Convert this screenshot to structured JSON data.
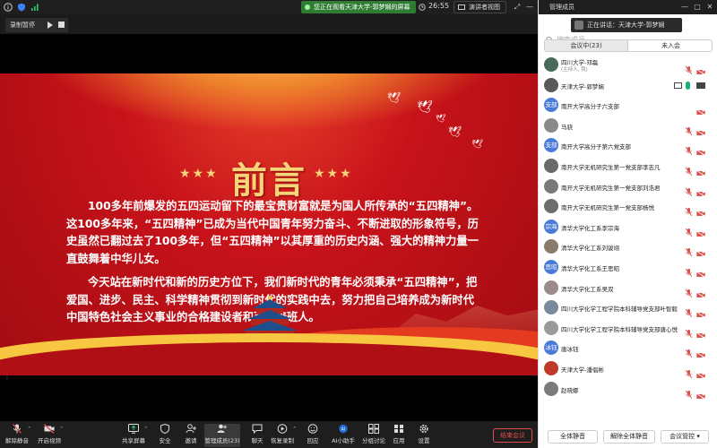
{
  "topbar": {
    "sharing_text": "您正在观看天津大学-郭梦娴的屏幕",
    "clock": "26:55",
    "view_button": "演讲者视图"
  },
  "recording": {
    "label": "录制暂停"
  },
  "slide": {
    "title": "前言",
    "stars_left": "★★★",
    "stars_right": "★★★",
    "paragraph1": "100多年前爆发的五四运动留下的最宝贵财富就是为国人所传承的“五四精神”。这100多年来，“五四精神”已成为当代中国青年努力奋斗、不断进取的形象符号，历史虽然已翻过去了100多年，但“五四精神”以其厚重的历史内涵、强大的精神力量一直鼓舞着中华儿女。",
    "paragraph2": "今天站在新时代和新的历史方位下，我们新时代的青年必须秉承“五四精神”，把爱国、进步、民主、科学精神贯彻到新时代的实践中去，努力把自己培养成为新时代中国特色社会主义事业的合格建设者和可靠接班人。"
  },
  "toolbar": {
    "items": [
      {
        "label": "解除静音",
        "icon": "mic-muted-icon"
      },
      {
        "label": "开启视频",
        "icon": "video-off-icon"
      },
      {
        "label": "共享屏幕",
        "icon": "share-screen-icon"
      },
      {
        "label": "安全",
        "icon": "shield-icon"
      },
      {
        "label": "邀请",
        "icon": "invite-icon"
      },
      {
        "label": "管理成员(23)",
        "icon": "members-icon"
      },
      {
        "label": "聊天",
        "icon": "chat-icon"
      },
      {
        "label": "恢复录制",
        "icon": "record-icon"
      },
      {
        "label": "回应",
        "icon": "reaction-icon"
      },
      {
        "label": "AI小助手",
        "icon": "ai-assistant-icon"
      },
      {
        "label": "分组讨论",
        "icon": "breakout-icon"
      },
      {
        "label": "应用",
        "icon": "apps-icon"
      },
      {
        "label": "设置",
        "icon": "gear-icon"
      }
    ],
    "end_meeting": "结束会议"
  },
  "panel": {
    "title": "管理成员",
    "speaking": "正在讲话：天津大学-郭梦娴",
    "search_placeholder": "搜索成员",
    "tabs": [
      {
        "label": "会议中(23)"
      },
      {
        "label": "未入会"
      }
    ],
    "participants": [
      {
        "name": "四川大学-邓磊",
        "sub": "(主持人, 我)",
        "avatar": "",
        "avatar_color": "#4a6b5a",
        "state": "muted"
      },
      {
        "name": "天津大学-郭梦娴",
        "sub": "",
        "avatar": "",
        "avatar_color": "#5a5a5a",
        "state": "speaking"
      },
      {
        "name": "南开大学高分子六支部",
        "sub": "",
        "avatar": "支部",
        "avatar_color": "#4b7bd9",
        "state": "camoff"
      },
      {
        "name": "马骁",
        "sub": "",
        "avatar": "",
        "avatar_color": "#8a8a8a",
        "state": "muted"
      },
      {
        "name": "南开大学高分子第六党支部",
        "sub": "",
        "avatar": "支部",
        "avatar_color": "#4b7bd9",
        "state": "muted"
      },
      {
        "name": "南开大学无机研究生第一党支部李志凡",
        "sub": "",
        "avatar": "",
        "avatar_color": "#6a6a6a",
        "state": "muted"
      },
      {
        "name": "南开大学无机研究生第一党支部刘浩君",
        "sub": "",
        "avatar": "",
        "avatar_color": "#7a7a7a",
        "state": "muted"
      },
      {
        "name": "南开大学无机研究生第一党支部杨悦",
        "sub": "",
        "avatar": "",
        "avatar_color": "#6d6d6d",
        "state": "muted"
      },
      {
        "name": "清华大学化工系李宗海",
        "sub": "",
        "avatar": "宗海",
        "avatar_color": "#4b7bd9",
        "state": "muted"
      },
      {
        "name": "清华大学化工系刘骏翊",
        "sub": "",
        "avatar": "",
        "avatar_color": "#8a7b6b",
        "state": "muted"
      },
      {
        "name": "清华大学化工系王思昭",
        "sub": "",
        "avatar": "思昭",
        "avatar_color": "#4b7bd9",
        "state": "muted"
      },
      {
        "name": "清华大学化工系吴双",
        "sub": "",
        "avatar": "",
        "avatar_color": "#9a8a8a",
        "state": "muted"
      },
      {
        "name": "四川大学化学工程学院本科辅导党支部叶智毅",
        "sub": "",
        "avatar": "",
        "avatar_color": "#7a8a9a",
        "state": "muted"
      },
      {
        "name": "四川大学化学工程学院本科辅导党支部唐心悦",
        "sub": "",
        "avatar": "",
        "avatar_color": "#9a9a9a",
        "state": "muted"
      },
      {
        "name": "唐冰钰",
        "sub": "",
        "avatar": "冰钰",
        "avatar_color": "#4b7bd9",
        "state": "muted"
      },
      {
        "name": "天津大学-潘倡彬",
        "sub": "",
        "avatar": "",
        "avatar_color": "#c0392b",
        "state": "muted"
      },
      {
        "name": "赵晓娜",
        "sub": "",
        "avatar": "",
        "avatar_color": "#7a7a7a",
        "state": "muted"
      }
    ],
    "footer": {
      "mute_all": "全体静音",
      "unmute_all": "解除全体静音",
      "control": "会议管控"
    }
  },
  "colors": {
    "slide_red": "#c8121a",
    "slide_gold": "#f7d37a",
    "end_red": "#e24b4b",
    "muted_red": "#d9534f",
    "speaking_green": "#19b26b",
    "banner_green": "#2e7d32"
  }
}
